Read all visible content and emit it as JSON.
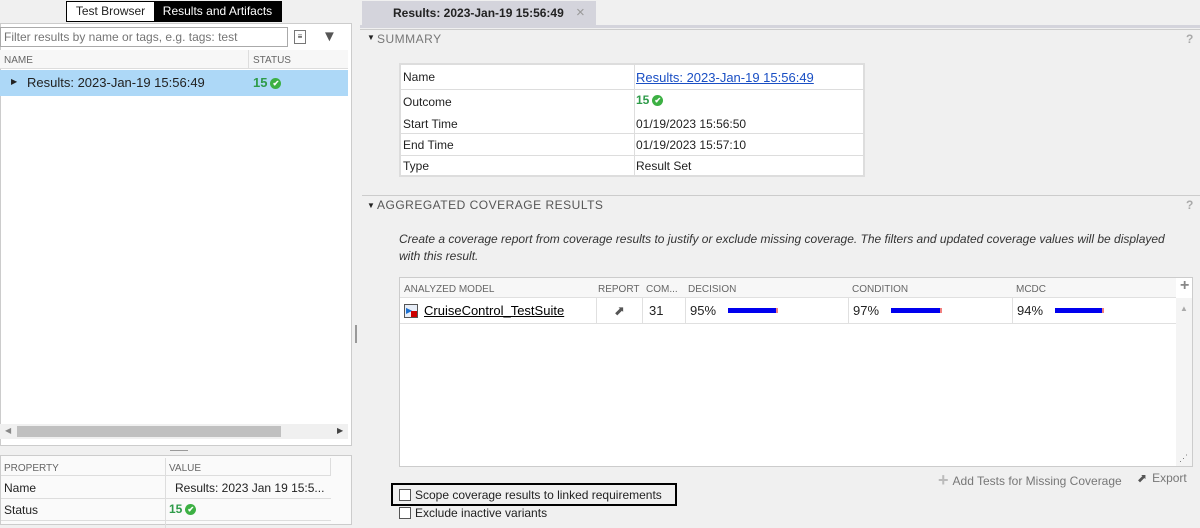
{
  "left": {
    "tabs": [
      {
        "label": "Test Browser",
        "active": false
      },
      {
        "label": "Results and Artifacts",
        "active": true
      }
    ],
    "filter_placeholder": "Filter results by name or tags, e.g. tags: test",
    "columns": {
      "name": "NAME",
      "status": "STATUS"
    },
    "rows": [
      {
        "name": "Results: 2023-Jan-19 15:56:49",
        "status": "15"
      }
    ],
    "properties": {
      "columns": {
        "property": "PROPERTY",
        "value": "VALUE"
      },
      "rows": [
        {
          "label": "Name",
          "value": "Results: 2023 Jan 19 15:5..."
        },
        {
          "label": "Status",
          "value": "15"
        }
      ]
    }
  },
  "doc_tab": {
    "label": "Results: 2023-Jan-19 15:56:49",
    "close": "×"
  },
  "summary": {
    "title": "SUMMARY",
    "help": "?",
    "rows": [
      {
        "label": "Name",
        "value": "Results: 2023-Jan-19 15:56:49"
      },
      {
        "label": "Outcome",
        "value": "15"
      },
      {
        "label": "Start Time",
        "value": "01/19/2023 15:56:50"
      },
      {
        "label": "End Time",
        "value": "01/19/2023 15:57:10"
      },
      {
        "label": "Type",
        "value": "Result Set"
      }
    ]
  },
  "coverage": {
    "title": "AGGREGATED COVERAGE RESULTS",
    "help": "?",
    "description": "Create a coverage report from coverage results to justify or exclude missing coverage. The filters and updated coverage values will be displayed with this result.",
    "columns": [
      "ANALYZED MODEL",
      "REPORT",
      "COM...",
      "DECISION",
      "CONDITION",
      "MCDC"
    ],
    "rows": [
      {
        "model": "CruiseControl_TestSuite",
        "complexity": "31",
        "decision": "95%",
        "condition": "97%",
        "mcdc": "94%",
        "decision_pct": 95,
        "condition_pct": 97,
        "mcdc_pct": 94
      }
    ],
    "add_tests": "Add Tests for Missing Coverage",
    "export": "Export",
    "scope_checkbox": {
      "label": "Scope coverage results to linked requirements",
      "checked": false
    },
    "exclude_checkbox": {
      "label": "Exclude inactive variants",
      "checked": false
    },
    "bar_color": "#0000ee"
  }
}
